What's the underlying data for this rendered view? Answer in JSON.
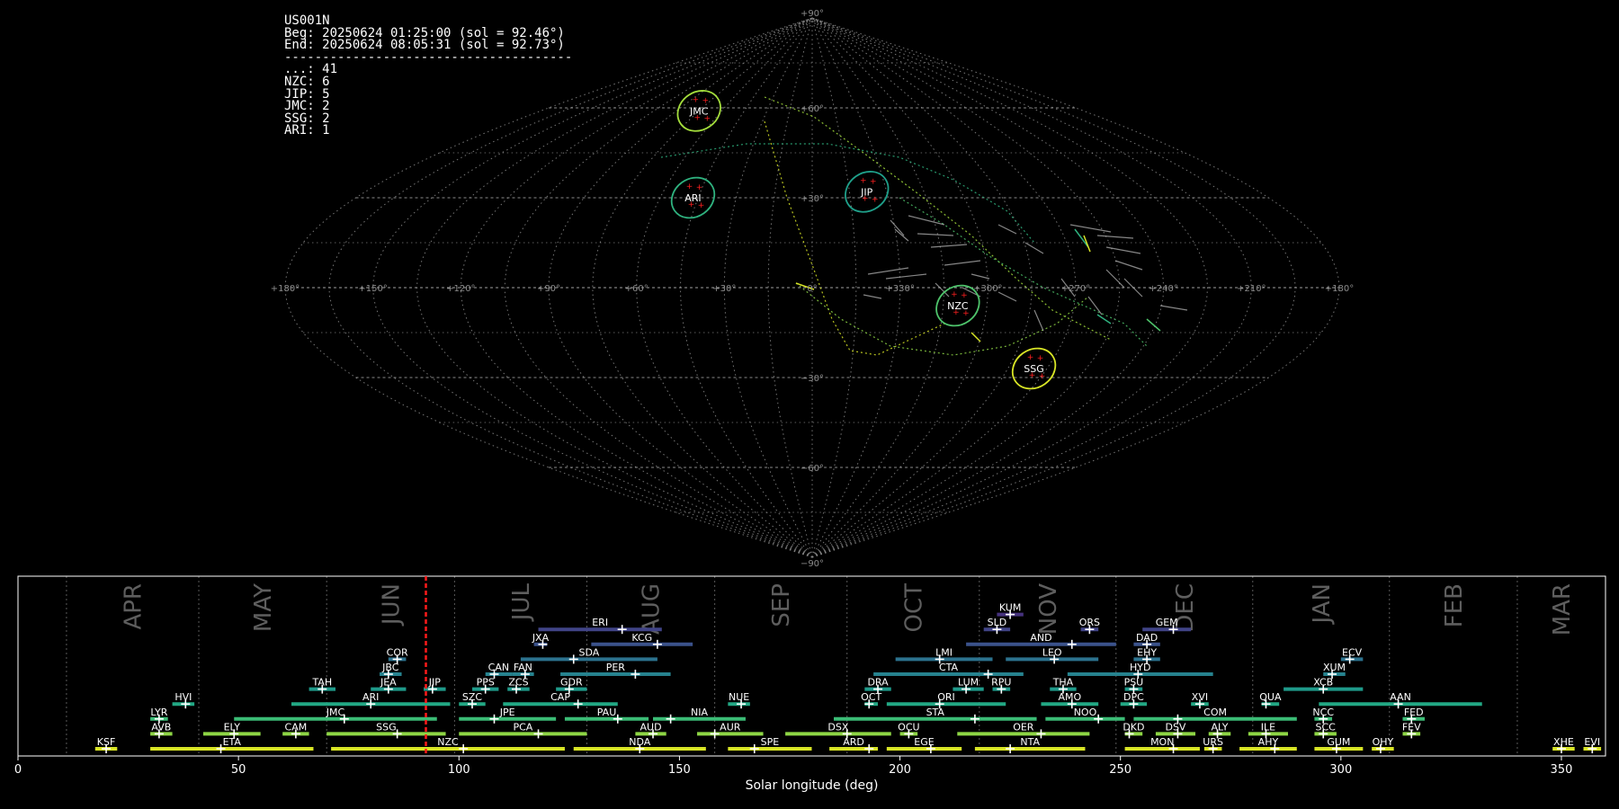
{
  "info": {
    "station": "US001N",
    "begin": "Beg: 20250624 01:25:00 (sol = 92.46°)",
    "end": "End: 20250624 08:05:31 (sol = 92.73°)",
    "separator": "--------------------------------------",
    "counts": [
      {
        "code": "...",
        "n": 41
      },
      {
        "code": "NZC",
        "n": 6
      },
      {
        "code": "JIP",
        "n": 5
      },
      {
        "code": "JMC",
        "n": 2
      },
      {
        "code": "SSG",
        "n": 2
      },
      {
        "code": "ARI",
        "n": 1
      }
    ]
  },
  "sky_map": {
    "projection": "sinusoidal",
    "lon_labels": [
      "+180°",
      "+150°",
      "+120°",
      "+90°",
      "+60°",
      "+30°",
      "0°",
      "+330°",
      "+300°",
      "+270°",
      "+240°",
      "+210°",
      "+180°"
    ],
    "lat_labels": [
      "+90°",
      "+60°",
      "+30°",
      "−30°",
      "−60°",
      "−90°"
    ],
    "radiants": [
      {
        "code": "JMC",
        "lon": 75,
        "lat": 59,
        "color": "#a4de3c"
      },
      {
        "code": "ARI",
        "lon": 47,
        "lat": 30,
        "color": "#2fb27f"
      },
      {
        "code": "JIP",
        "lon": 338,
        "lat": 32,
        "color": "#1fa08a"
      },
      {
        "code": "NZC",
        "lon": 310,
        "lat": -6,
        "color": "#4ec36b"
      },
      {
        "code": "SSG",
        "lon": 275,
        "lat": -27,
        "color": "#d8e526"
      }
    ]
  },
  "chart_data": {
    "type": "timeline",
    "xlabel": "Solar longitude (deg)",
    "xlim": [
      0,
      360
    ],
    "xticks": [
      0,
      50,
      100,
      150,
      200,
      250,
      300,
      350
    ],
    "current_sol": 92.5,
    "months": [
      {
        "label": "APR",
        "start": 11
      },
      {
        "label": "MAY",
        "start": 41
      },
      {
        "label": "JUN",
        "start": 70
      },
      {
        "label": "JUL",
        "start": 99
      },
      {
        "label": "AUG",
        "start": 129
      },
      {
        "label": "SEP",
        "start": 158
      },
      {
        "label": "OCT",
        "start": 188
      },
      {
        "label": "NOV",
        "start": 218
      },
      {
        "label": "DEC",
        "start": 249
      },
      {
        "label": "JAN",
        "start": 280
      },
      {
        "label": "FEB",
        "start": 311
      },
      {
        "label": "MAR",
        "start": 340
      }
    ],
    "showers": [
      {
        "code": "KSF",
        "start": 17.5,
        "end": 22.5,
        "peak": 20,
        "row": 0,
        "color": "#d8e526"
      },
      {
        "code": "ETA",
        "start": 30,
        "end": 67,
        "peak": 46,
        "row": 0,
        "color": "#d8e526"
      },
      {
        "code": "NZC",
        "start": 71,
        "end": 124,
        "peak": 101,
        "row": 0,
        "color": "#d8e526"
      },
      {
        "code": "NDA",
        "start": 126,
        "end": 156,
        "peak": 141,
        "row": 0,
        "color": "#d8e526"
      },
      {
        "code": "SPE",
        "start": 161,
        "end": 180,
        "peak": 167,
        "row": 0,
        "color": "#d8e526"
      },
      {
        "code": "ARD",
        "start": 184,
        "end": 195,
        "peak": 193,
        "row": 0,
        "color": "#d8e526"
      },
      {
        "code": "EGE",
        "start": 197,
        "end": 214,
        "peak": 207,
        "row": 0,
        "color": "#d8e526"
      },
      {
        "code": "NTA",
        "start": 217,
        "end": 242,
        "peak": 225,
        "row": 0,
        "color": "#d8e526"
      },
      {
        "code": "MON",
        "start": 251,
        "end": 268,
        "peak": 262,
        "row": 0,
        "color": "#d8e526"
      },
      {
        "code": "URS",
        "start": 269,
        "end": 273,
        "peak": 271,
        "row": 0,
        "color": "#d8e526"
      },
      {
        "code": "AHY",
        "start": 277,
        "end": 290,
        "peak": 285,
        "row": 0,
        "color": "#d8e526"
      },
      {
        "code": "GUM",
        "start": 294,
        "end": 305,
        "peak": 299,
        "row": 0,
        "color": "#d8e526"
      },
      {
        "code": "OHY",
        "start": 307,
        "end": 312,
        "peak": 309,
        "row": 0,
        "color": "#d8e526"
      },
      {
        "code": "XHE",
        "start": 348,
        "end": 353,
        "peak": 350,
        "row": 0,
        "color": "#d8e526"
      },
      {
        "code": "EVI",
        "start": 355,
        "end": 359,
        "peak": 357,
        "row": 0,
        "color": "#d8e526"
      },
      {
        "code": "AVB",
        "start": 30,
        "end": 35,
        "peak": 32,
        "row": 1,
        "color": "#8ed645"
      },
      {
        "code": "ELY",
        "start": 42,
        "end": 55,
        "peak": 49,
        "row": 1,
        "color": "#8ed645"
      },
      {
        "code": "CAM",
        "start": 60,
        "end": 66,
        "peak": 63,
        "row": 1,
        "color": "#8ed645"
      },
      {
        "code": "SSG",
        "start": 70,
        "end": 97,
        "peak": 86,
        "row": 1,
        "color": "#8ed645"
      },
      {
        "code": "PCA",
        "start": 100,
        "end": 129,
        "peak": 118,
        "row": 1,
        "color": "#8ed645"
      },
      {
        "code": "AUD",
        "start": 140,
        "end": 147,
        "peak": 144,
        "row": 1,
        "color": "#8ed645"
      },
      {
        "code": "AUR",
        "start": 154,
        "end": 169,
        "peak": 158,
        "row": 1,
        "color": "#8ed645"
      },
      {
        "code": "DSX",
        "start": 174,
        "end": 198,
        "peak": 188,
        "row": 1,
        "color": "#8ed645"
      },
      {
        "code": "OCU",
        "start": 200,
        "end": 204,
        "peak": 202,
        "row": 1,
        "color": "#8ed645"
      },
      {
        "code": "OER",
        "start": 213,
        "end": 243,
        "peak": 232,
        "row": 1,
        "color": "#8ed645"
      },
      {
        "code": "DKD",
        "start": 251,
        "end": 255,
        "peak": 252,
        "row": 1,
        "color": "#8ed645"
      },
      {
        "code": "DSV",
        "start": 258,
        "end": 267,
        "peak": 263,
        "row": 1,
        "color": "#8ed645"
      },
      {
        "code": "ALY",
        "start": 270,
        "end": 275,
        "peak": 272,
        "row": 1,
        "color": "#8ed645"
      },
      {
        "code": "ILE",
        "start": 279,
        "end": 288,
        "peak": 283,
        "row": 1,
        "color": "#8ed645"
      },
      {
        "code": "SCC",
        "start": 294,
        "end": 299,
        "peak": 296,
        "row": 1,
        "color": "#8ed645"
      },
      {
        "code": "FEV",
        "start": 314,
        "end": 318,
        "peak": 316,
        "row": 1,
        "color": "#8ed645"
      },
      {
        "code": "LYR",
        "start": 30,
        "end": 34,
        "peak": 32,
        "row": 2,
        "color": "#3bbb75"
      },
      {
        "code": "JMC",
        "start": 49,
        "end": 95,
        "peak": 74,
        "row": 2,
        "color": "#3bbb75"
      },
      {
        "code": "JPE",
        "start": 100,
        "end": 122,
        "peak": 108,
        "row": 2,
        "color": "#3bbb75"
      },
      {
        "code": "PAU",
        "start": 124,
        "end": 143,
        "peak": 136,
        "row": 2,
        "color": "#3bbb75"
      },
      {
        "code": "NIA",
        "start": 144,
        "end": 165,
        "peak": 148,
        "row": 2,
        "color": "#3bbb75"
      },
      {
        "code": "STA",
        "start": 185,
        "end": 231,
        "peak": 217,
        "row": 2,
        "color": "#3bbb75"
      },
      {
        "code": "NOO",
        "start": 233,
        "end": 251,
        "peak": 245,
        "row": 2,
        "color": "#3bbb75"
      },
      {
        "code": "COM",
        "start": 253,
        "end": 290,
        "peak": 263,
        "row": 2,
        "color": "#3bbb75"
      },
      {
        "code": "NCC",
        "start": 294,
        "end": 298,
        "peak": 296,
        "row": 2,
        "color": "#3bbb75"
      },
      {
        "code": "FED",
        "start": 314,
        "end": 319,
        "peak": 316,
        "row": 2,
        "color": "#3bbb75"
      },
      {
        "code": "HVI",
        "start": 35,
        "end": 40,
        "peak": 38,
        "row": 3,
        "color": "#22a884"
      },
      {
        "code": "ARI",
        "start": 62,
        "end": 98,
        "peak": 80,
        "row": 3,
        "color": "#22a884"
      },
      {
        "code": "SZC",
        "start": 100,
        "end": 106,
        "peak": 103,
        "row": 3,
        "color": "#22a884"
      },
      {
        "code": "CAP",
        "start": 110,
        "end": 136,
        "peak": 127,
        "row": 3,
        "color": "#22a884"
      },
      {
        "code": "NUE",
        "start": 161,
        "end": 166,
        "peak": 164,
        "row": 3,
        "color": "#22a884"
      },
      {
        "code": "OCT",
        "start": 192,
        "end": 195,
        "peak": 193,
        "row": 3,
        "color": "#22a884"
      },
      {
        "code": "ORI",
        "start": 197,
        "end": 224,
        "peak": 209,
        "row": 3,
        "color": "#22a884"
      },
      {
        "code": "AMO",
        "start": 232,
        "end": 245,
        "peak": 239,
        "row": 3,
        "color": "#22a884"
      },
      {
        "code": "DPC",
        "start": 250,
        "end": 256,
        "peak": 253,
        "row": 3,
        "color": "#22a884"
      },
      {
        "code": "XVI",
        "start": 266,
        "end": 270,
        "peak": 268,
        "row": 3,
        "color": "#22a884"
      },
      {
        "code": "QUA",
        "start": 282,
        "end": 286,
        "peak": 283,
        "row": 3,
        "color": "#22a884"
      },
      {
        "code": "AAN",
        "start": 295,
        "end": 332,
        "peak": 313,
        "row": 3,
        "color": "#22a884"
      },
      {
        "code": "TAH",
        "start": 66,
        "end": 72,
        "peak": 69,
        "row": 4,
        "color": "#1f9a8a"
      },
      {
        "code": "JEA",
        "start": 80,
        "end": 88,
        "peak": 84,
        "row": 4,
        "color": "#1f9a8a"
      },
      {
        "code": "JIP",
        "start": 92,
        "end": 97,
        "peak": 94,
        "row": 4,
        "color": "#1f9a8a"
      },
      {
        "code": "PPS",
        "start": 103,
        "end": 109,
        "peak": 106,
        "row": 4,
        "color": "#1f9a8a"
      },
      {
        "code": "ZCS",
        "start": 111,
        "end": 116,
        "peak": 113,
        "row": 4,
        "color": "#1f9a8a"
      },
      {
        "code": "GDR",
        "start": 122,
        "end": 129,
        "peak": 125,
        "row": 4,
        "color": "#1f9a8a"
      },
      {
        "code": "DRA",
        "start": 192,
        "end": 198,
        "peak": 195,
        "row": 4,
        "color": "#1f9a8a"
      },
      {
        "code": "LUM",
        "start": 212,
        "end": 219,
        "peak": 215,
        "row": 4,
        "color": "#1f9a8a"
      },
      {
        "code": "RPU",
        "start": 221,
        "end": 225,
        "peak": 223,
        "row": 4,
        "color": "#1f9a8a"
      },
      {
        "code": "THA",
        "start": 234,
        "end": 240,
        "peak": 237,
        "row": 4,
        "color": "#1f9a8a"
      },
      {
        "code": "PSU",
        "start": 251,
        "end": 255,
        "peak": 253,
        "row": 4,
        "color": "#1f9a8a"
      },
      {
        "code": "XCB",
        "start": 287,
        "end": 305,
        "peak": 296,
        "row": 4,
        "color": "#1f9a8a"
      },
      {
        "code": "JBC",
        "start": 82,
        "end": 87,
        "peak": 84,
        "row": 5,
        "color": "#26828e"
      },
      {
        "code": "CAN",
        "start": 106,
        "end": 112,
        "peak": 108,
        "row": 5,
        "color": "#26828e"
      },
      {
        "code": "FAN",
        "start": 112,
        "end": 117,
        "peak": 115,
        "row": 5,
        "color": "#26828e"
      },
      {
        "code": "PER",
        "start": 123,
        "end": 148,
        "peak": 140,
        "row": 5,
        "color": "#26828e"
      },
      {
        "code": "CTA",
        "start": 194,
        "end": 228,
        "peak": 220,
        "row": 5,
        "color": "#26828e"
      },
      {
        "code": "HYD",
        "start": 238,
        "end": 271,
        "peak": 254,
        "row": 5,
        "color": "#26828e"
      },
      {
        "code": "XUM",
        "start": 296,
        "end": 301,
        "peak": 298,
        "row": 5,
        "color": "#26828e"
      },
      {
        "code": "COR",
        "start": 84,
        "end": 88,
        "peak": 86,
        "row": 6,
        "color": "#2c728e"
      },
      {
        "code": "SDA",
        "start": 114,
        "end": 145,
        "peak": 126,
        "row": 6,
        "color": "#2c728e"
      },
      {
        "code": "LMI",
        "start": 199,
        "end": 221,
        "peak": 209,
        "row": 6,
        "color": "#2c728e"
      },
      {
        "code": "LEO",
        "start": 224,
        "end": 245,
        "peak": 235,
        "row": 6,
        "color": "#2c728e"
      },
      {
        "code": "EHY",
        "start": 253,
        "end": 259,
        "peak": 256,
        "row": 6,
        "color": "#2c728e"
      },
      {
        "code": "ECV",
        "start": 300,
        "end": 305,
        "peak": 302,
        "row": 6,
        "color": "#2c728e"
      },
      {
        "code": "JXA",
        "start": 117,
        "end": 120,
        "peak": 119,
        "row": 7,
        "color": "#3b528b"
      },
      {
        "code": "KCG",
        "start": 130,
        "end": 153,
        "peak": 145,
        "row": 7,
        "color": "#3b528b"
      },
      {
        "code": "AND",
        "start": 215,
        "end": 249,
        "peak": 239,
        "row": 7,
        "color": "#3b528b"
      },
      {
        "code": "DAD",
        "start": 253,
        "end": 259,
        "peak": 256,
        "row": 7,
        "color": "#3b528b"
      },
      {
        "code": "ERI",
        "start": 118,
        "end": 146,
        "peak": 137,
        "row": 8,
        "color": "#414487"
      },
      {
        "code": "SLD",
        "start": 219,
        "end": 225,
        "peak": 222,
        "row": 8,
        "color": "#414487"
      },
      {
        "code": "ORS",
        "start": 241,
        "end": 245,
        "peak": 243,
        "row": 8,
        "color": "#414487"
      },
      {
        "code": "GEM",
        "start": 255,
        "end": 266,
        "peak": 262,
        "row": 8,
        "color": "#414487"
      },
      {
        "code": "KUM",
        "start": 222,
        "end": 228,
        "peak": 225,
        "row": 9,
        "color": "#46327e"
      }
    ]
  }
}
